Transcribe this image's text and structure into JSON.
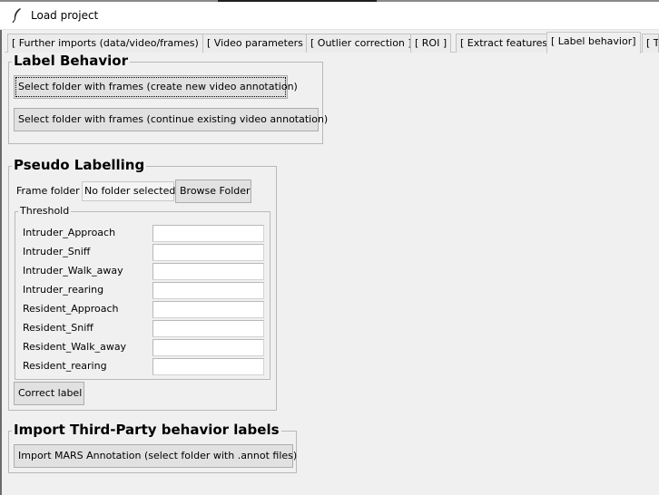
{
  "window": {
    "title": "Load project"
  },
  "tabs": [
    "[ Further imports (data/video/frames) ]",
    "[ Video parameters ]",
    "[ Outlier correction ]",
    "[ ROI ]",
    "[ Extract features ]",
    "[ Label behavior]",
    "[ T"
  ],
  "active_tab_index": 5,
  "label_behavior": {
    "title": "Label Behavior",
    "new_annotation_button": "Select folder with frames (create new video annotation)",
    "continue_annotation_button": "Select folder with frames (continue existing video annotation)"
  },
  "pseudo_labelling": {
    "title": "Pseudo Labelling",
    "frame_folder_label": "Frame folder",
    "folder_status": "No folder selected",
    "browse_button": "Browse Folder",
    "threshold": {
      "title": "Threshold",
      "rows": [
        {
          "label": "Intruder_Approach",
          "value": ""
        },
        {
          "label": "Intruder_Sniff",
          "value": ""
        },
        {
          "label": "Intruder_Walk_away",
          "value": ""
        },
        {
          "label": "Intruder_rearing",
          "value": ""
        },
        {
          "label": "Resident_Approach",
          "value": ""
        },
        {
          "label": "Resident_Sniff",
          "value": ""
        },
        {
          "label": "Resident_Walk_away",
          "value": ""
        },
        {
          "label": "Resident_rearing",
          "value": ""
        }
      ]
    },
    "correct_label_button": "Correct label"
  },
  "third_party": {
    "title": "Import Third-Party behavior labels",
    "mars_button": "Import MARS Annotation (select folder with .annot files)"
  }
}
